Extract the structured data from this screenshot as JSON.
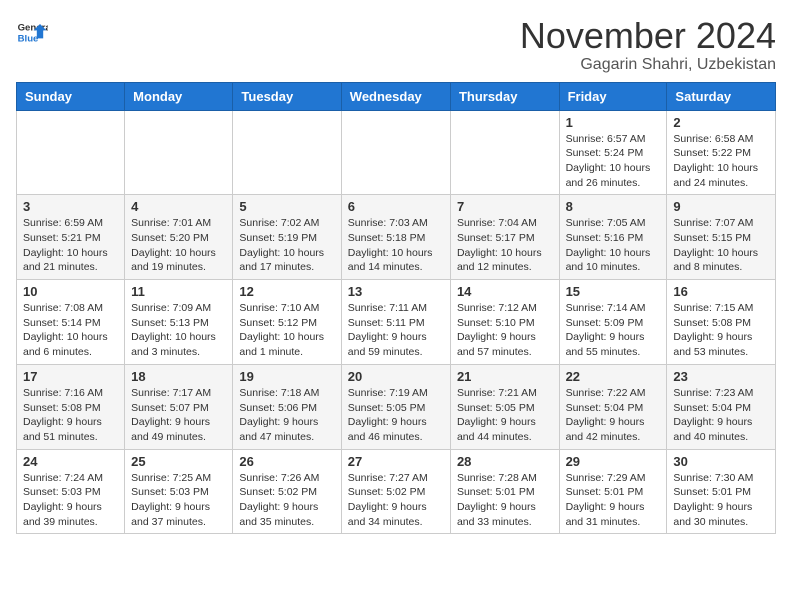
{
  "header": {
    "logo_general": "General",
    "logo_blue": "Blue",
    "month_title": "November 2024",
    "location": "Gagarin Shahri, Uzbekistan"
  },
  "weekdays": [
    "Sunday",
    "Monday",
    "Tuesday",
    "Wednesday",
    "Thursday",
    "Friday",
    "Saturday"
  ],
  "weeks": [
    [
      {
        "day": "",
        "info": ""
      },
      {
        "day": "",
        "info": ""
      },
      {
        "day": "",
        "info": ""
      },
      {
        "day": "",
        "info": ""
      },
      {
        "day": "",
        "info": ""
      },
      {
        "day": "1",
        "info": "Sunrise: 6:57 AM\nSunset: 5:24 PM\nDaylight: 10 hours and 26 minutes."
      },
      {
        "day": "2",
        "info": "Sunrise: 6:58 AM\nSunset: 5:22 PM\nDaylight: 10 hours and 24 minutes."
      }
    ],
    [
      {
        "day": "3",
        "info": "Sunrise: 6:59 AM\nSunset: 5:21 PM\nDaylight: 10 hours and 21 minutes."
      },
      {
        "day": "4",
        "info": "Sunrise: 7:01 AM\nSunset: 5:20 PM\nDaylight: 10 hours and 19 minutes."
      },
      {
        "day": "5",
        "info": "Sunrise: 7:02 AM\nSunset: 5:19 PM\nDaylight: 10 hours and 17 minutes."
      },
      {
        "day": "6",
        "info": "Sunrise: 7:03 AM\nSunset: 5:18 PM\nDaylight: 10 hours and 14 minutes."
      },
      {
        "day": "7",
        "info": "Sunrise: 7:04 AM\nSunset: 5:17 PM\nDaylight: 10 hours and 12 minutes."
      },
      {
        "day": "8",
        "info": "Sunrise: 7:05 AM\nSunset: 5:16 PM\nDaylight: 10 hours and 10 minutes."
      },
      {
        "day": "9",
        "info": "Sunrise: 7:07 AM\nSunset: 5:15 PM\nDaylight: 10 hours and 8 minutes."
      }
    ],
    [
      {
        "day": "10",
        "info": "Sunrise: 7:08 AM\nSunset: 5:14 PM\nDaylight: 10 hours and 6 minutes."
      },
      {
        "day": "11",
        "info": "Sunrise: 7:09 AM\nSunset: 5:13 PM\nDaylight: 10 hours and 3 minutes."
      },
      {
        "day": "12",
        "info": "Sunrise: 7:10 AM\nSunset: 5:12 PM\nDaylight: 10 hours and 1 minute."
      },
      {
        "day": "13",
        "info": "Sunrise: 7:11 AM\nSunset: 5:11 PM\nDaylight: 9 hours and 59 minutes."
      },
      {
        "day": "14",
        "info": "Sunrise: 7:12 AM\nSunset: 5:10 PM\nDaylight: 9 hours and 57 minutes."
      },
      {
        "day": "15",
        "info": "Sunrise: 7:14 AM\nSunset: 5:09 PM\nDaylight: 9 hours and 55 minutes."
      },
      {
        "day": "16",
        "info": "Sunrise: 7:15 AM\nSunset: 5:08 PM\nDaylight: 9 hours and 53 minutes."
      }
    ],
    [
      {
        "day": "17",
        "info": "Sunrise: 7:16 AM\nSunset: 5:08 PM\nDaylight: 9 hours and 51 minutes."
      },
      {
        "day": "18",
        "info": "Sunrise: 7:17 AM\nSunset: 5:07 PM\nDaylight: 9 hours and 49 minutes."
      },
      {
        "day": "19",
        "info": "Sunrise: 7:18 AM\nSunset: 5:06 PM\nDaylight: 9 hours and 47 minutes."
      },
      {
        "day": "20",
        "info": "Sunrise: 7:19 AM\nSunset: 5:05 PM\nDaylight: 9 hours and 46 minutes."
      },
      {
        "day": "21",
        "info": "Sunrise: 7:21 AM\nSunset: 5:05 PM\nDaylight: 9 hours and 44 minutes."
      },
      {
        "day": "22",
        "info": "Sunrise: 7:22 AM\nSunset: 5:04 PM\nDaylight: 9 hours and 42 minutes."
      },
      {
        "day": "23",
        "info": "Sunrise: 7:23 AM\nSunset: 5:04 PM\nDaylight: 9 hours and 40 minutes."
      }
    ],
    [
      {
        "day": "24",
        "info": "Sunrise: 7:24 AM\nSunset: 5:03 PM\nDaylight: 9 hours and 39 minutes."
      },
      {
        "day": "25",
        "info": "Sunrise: 7:25 AM\nSunset: 5:03 PM\nDaylight: 9 hours and 37 minutes."
      },
      {
        "day": "26",
        "info": "Sunrise: 7:26 AM\nSunset: 5:02 PM\nDaylight: 9 hours and 35 minutes."
      },
      {
        "day": "27",
        "info": "Sunrise: 7:27 AM\nSunset: 5:02 PM\nDaylight: 9 hours and 34 minutes."
      },
      {
        "day": "28",
        "info": "Sunrise: 7:28 AM\nSunset: 5:01 PM\nDaylight: 9 hours and 33 minutes."
      },
      {
        "day": "29",
        "info": "Sunrise: 7:29 AM\nSunset: 5:01 PM\nDaylight: 9 hours and 31 minutes."
      },
      {
        "day": "30",
        "info": "Sunrise: 7:30 AM\nSunset: 5:01 PM\nDaylight: 9 hours and 30 minutes."
      }
    ]
  ]
}
